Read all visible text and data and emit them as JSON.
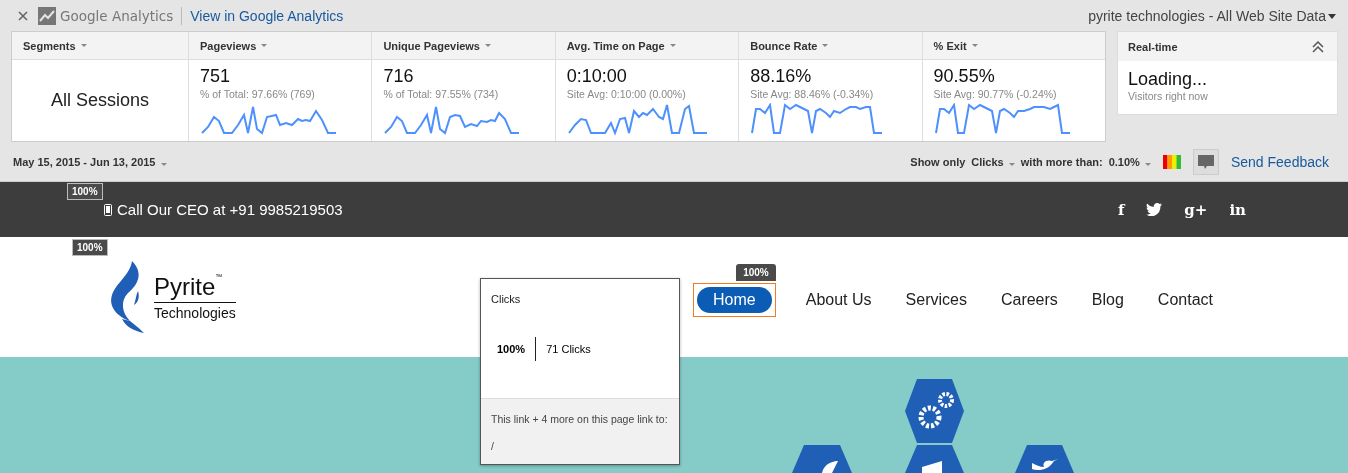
{
  "ga_bar": {
    "logo_text": "Google Analytics",
    "view_link": "View in Google Analytics",
    "property": "pyrite technologies - All Web Site Data"
  },
  "metrics": {
    "segment_header": "Segments",
    "segment": "All Sessions",
    "columns": [
      {
        "header": "Pageviews",
        "value": "751",
        "note": "% of Total: 97.66% (769)"
      },
      {
        "header": "Unique Pageviews",
        "value": "716",
        "note": "% of Total: 97.55% (734)"
      },
      {
        "header": "Avg. Time on Page",
        "value": "0:10:00",
        "note": "Site Avg: 0:10:00 (0.00%)"
      },
      {
        "header": "Bounce Rate",
        "value": "88.16%",
        "note": "Site Avg: 88.46% (-0.34%)"
      },
      {
        "header": "% Exit",
        "value": "90.55%",
        "note": "Site Avg: 90.77% (-0.24%)"
      }
    ]
  },
  "realtime": {
    "title": "Real-time",
    "value": "Loading...",
    "caption": "Visitors right now"
  },
  "date_range": "May 15, 2015 - Jun 13, 2015",
  "filter": {
    "show_only": "Show only",
    "metric": "Clicks",
    "with_more": "with more than:",
    "threshold": "0.10%",
    "feedback": "Send Feedback"
  },
  "site": {
    "top_bar": {
      "badge": "100%",
      "call": "Call Our CEO at +91 9985219503",
      "social": [
        {
          "kind": "text",
          "label": "f"
        },
        {
          "kind": "bird"
        },
        {
          "kind": "text",
          "label": "g+"
        },
        {
          "kind": "text",
          "label": "in"
        }
      ]
    },
    "logo": {
      "badge": "100%",
      "name": "Pyrite",
      "trademark": "™",
      "tagline": "Technologies"
    },
    "nav": [
      {
        "label": "Home",
        "selected": true,
        "badge": "100%"
      },
      {
        "label": "About Us",
        "selected": false
      },
      {
        "label": "Services",
        "selected": false
      },
      {
        "label": "Careers",
        "selected": false
      },
      {
        "label": "Blog",
        "selected": false
      },
      {
        "label": "Contact",
        "selected": false
      }
    ]
  },
  "popup": {
    "title": "Clicks",
    "percent": "100%",
    "clicks": "71 Clicks",
    "note": "This link + 4 more on this page link to:",
    "target": "/"
  }
}
